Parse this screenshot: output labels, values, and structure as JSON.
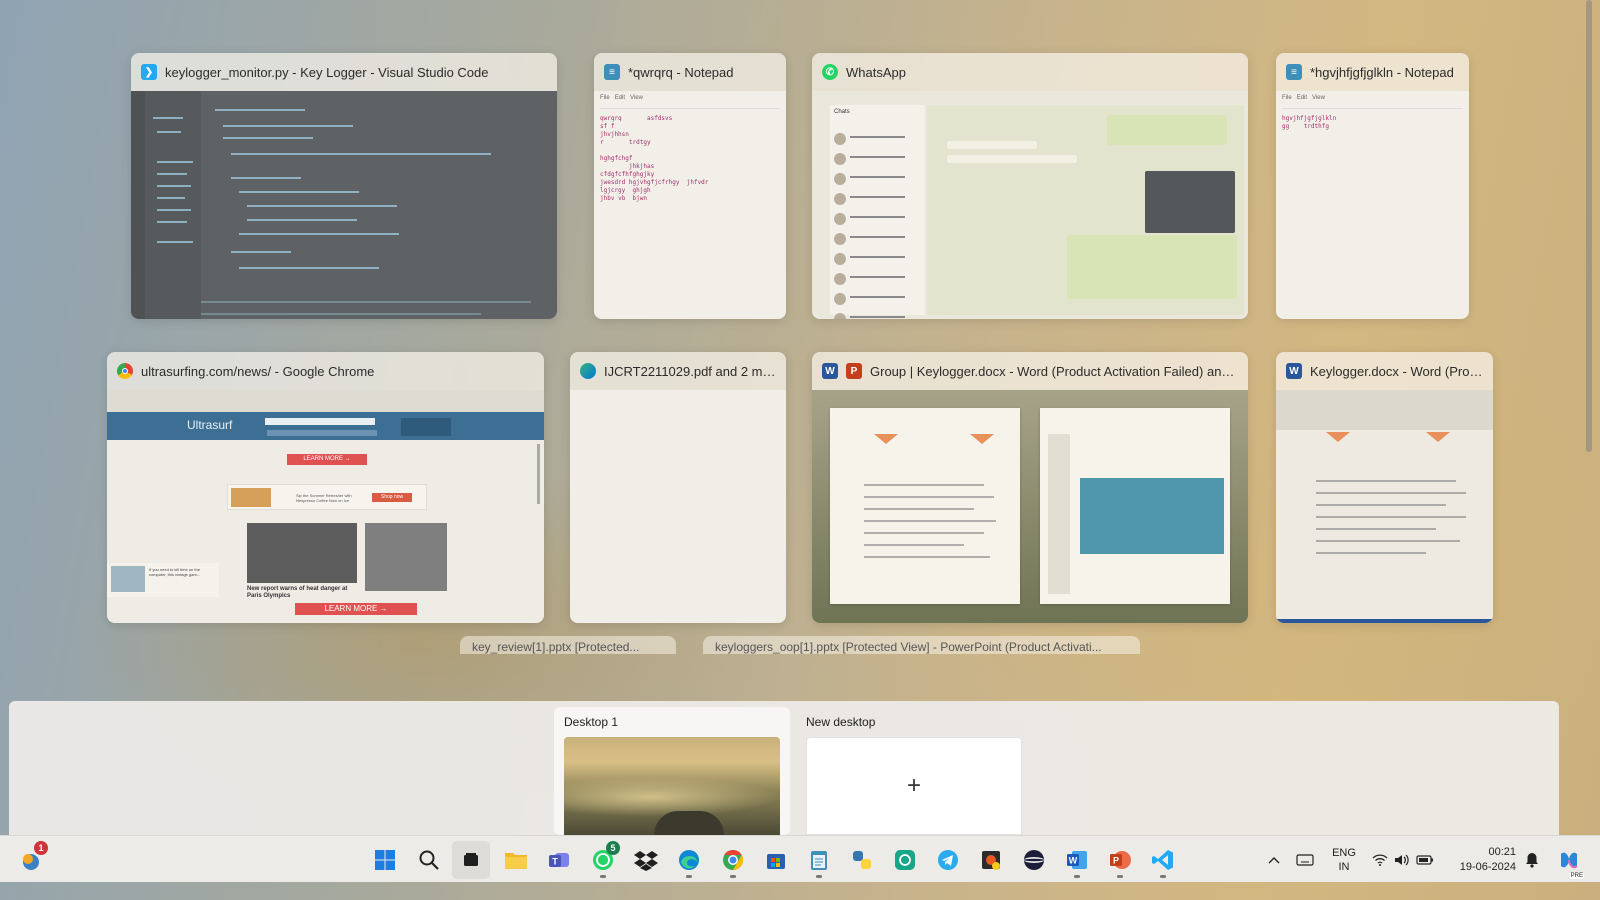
{
  "windows": [
    {
      "title": "keylogger_monitor.py - Key Logger - Visual Studio Code",
      "icon": "vscode-icon"
    },
    {
      "title": "*qwrqrq - Notepad",
      "icon": "notepad-icon"
    },
    {
      "title": "WhatsApp",
      "icon": "whatsapp-icon"
    },
    {
      "title": "*hgvjhfjgfjglkln - Notepad",
      "icon": "notepad-icon"
    },
    {
      "title": "ultrasurfing.com/news/ - Google Chrome",
      "icon": "chrome-icon"
    },
    {
      "title": "IJCRT2211029.pdf and 2 more...",
      "icon": "edge-icon"
    },
    {
      "title": "Group | Keylogger.docx - Word (Product Activation Failed) and 1 ot...",
      "icon": "word-powerpoint-icon"
    },
    {
      "title": "Keylogger.docx - Word (Prod...",
      "icon": "word-icon"
    }
  ],
  "thumbs": {
    "notepad1": {
      "menu": [
        "File",
        "Edit",
        "View"
      ],
      "lines": [
        "qwrqrq",
        "asfdsvs",
        "sf f",
        "jhvjhhsn",
        "r",
        "trdtgy",
        "hghgfchgf",
        "jhkjhas",
        "cfdgfcfhfghgjky",
        "jwesdrd",
        "hgjvhgfjcfrhgy",
        "jhfvdr",
        "lgjcrgy",
        "ghjgh",
        "jhbv",
        "vb",
        "bjwn"
      ]
    },
    "notepad2": {
      "menu": [
        "File",
        "Edit",
        "View"
      ],
      "lines": [
        "hgvjhfjgfjglkln",
        "gg",
        "trdthfg"
      ]
    },
    "whatsapp": {
      "heading": "Chats"
    },
    "chrome": {
      "brand": "Ultrasurf",
      "learn_more": "LEARN MORE →",
      "ad_text": "If you need to kill time on the computer, this vintage gam...",
      "headline": "New report warns of heat danger at Paris Olympics",
      "promo": "Sip the Summer Refresher with Nespresso Coffee Now on Ice",
      "shop": "Shop now"
    }
  },
  "peeks": [
    {
      "title": "key_review[1].pptx  [Protected..."
    },
    {
      "title": "keyloggers_oop[1].pptx  [Protected View] - PowerPoint (Product Activati..."
    }
  ],
  "desktops": [
    {
      "label": "Desktop 1"
    },
    {
      "label": "New desktop",
      "plus": "+"
    }
  ],
  "taskbar": {
    "apps": [
      {
        "name": "start-button"
      },
      {
        "name": "search-button"
      },
      {
        "name": "task-view-button"
      },
      {
        "name": "file-explorer"
      },
      {
        "name": "teams"
      },
      {
        "name": "whatsapp",
        "badge": "5"
      },
      {
        "name": "dropbox"
      },
      {
        "name": "edge"
      },
      {
        "name": "chrome"
      },
      {
        "name": "microsoft-store"
      },
      {
        "name": "notepad"
      },
      {
        "name": "python-launcher"
      },
      {
        "name": "chatgpt"
      },
      {
        "name": "telegram"
      },
      {
        "name": "antivirus"
      },
      {
        "name": "vpn"
      },
      {
        "name": "word"
      },
      {
        "name": "powerpoint"
      },
      {
        "name": "vscode"
      }
    ],
    "weather_badge": "1",
    "lang_line1": "ENG",
    "lang_line2": "IN",
    "time": "00:21",
    "date": "19-06-2024",
    "copilot_badge": "PRE"
  },
  "colors": {
    "accent": "#0078d4",
    "whatsapp": "#25d366",
    "word": "#2b579a",
    "powerpoint": "#c43e1c",
    "vscode": "#23a9f2"
  }
}
